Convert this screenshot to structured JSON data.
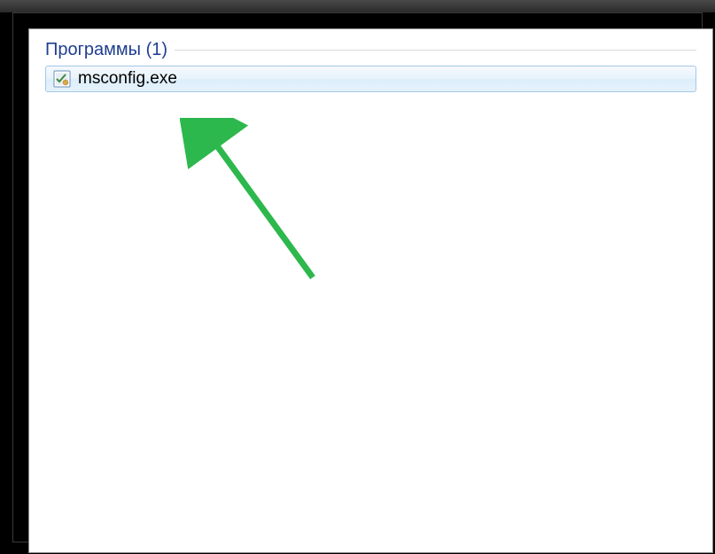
{
  "search": {
    "group_label": "Программы (1)",
    "results": [
      {
        "label": "msconfig.exe",
        "icon": "msconfig-icon"
      }
    ]
  },
  "annotation": {
    "arrow_color": "#2db84d"
  }
}
